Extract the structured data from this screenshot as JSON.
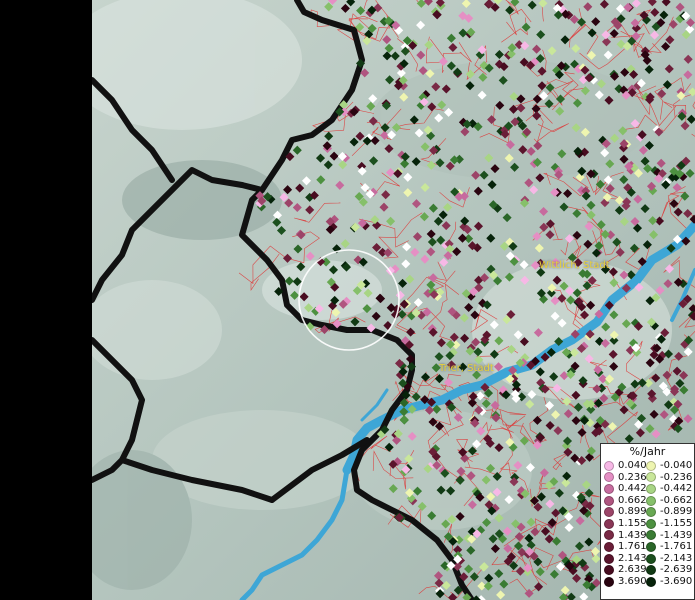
{
  "map": {
    "cities": [
      {
        "name": "Wittlich, Stadt"
      },
      {
        "name": "Trier, Stadt"
      }
    ],
    "colors": {
      "terrain_light": "#c9d6cf",
      "terrain_mid": "#a9bab3",
      "terrain_shadow": "#8a9c96",
      "boundary_major": "#111111",
      "boundary_minor": "#e03030",
      "river": "#3ea6d6",
      "selection_ring": "#ffffff",
      "city_label": "#e8d23a"
    }
  },
  "legend": {
    "title": "%/Jahr",
    "positive": [
      {
        "value": "0.040",
        "color": "#f7b8e6"
      },
      {
        "value": "0.236",
        "color": "#e58fc4"
      },
      {
        "value": "0.442",
        "color": "#c76b9e"
      },
      {
        "value": "0.662",
        "color": "#b05580"
      },
      {
        "value": "0.899",
        "color": "#9c4468"
      },
      {
        "value": "1.155",
        "color": "#8a3656"
      },
      {
        "value": "1.439",
        "color": "#7a2a46"
      },
      {
        "value": "1.761",
        "color": "#6b1e38"
      },
      {
        "value": "2.143",
        "color": "#5a142c"
      },
      {
        "value": "2.639",
        "color": "#480c20"
      },
      {
        "value": "3.690",
        "color": "#2a0410"
      }
    ],
    "negative": [
      {
        "value": "-0.040",
        "color": "#eef5b0"
      },
      {
        "value": "-0.236",
        "color": "#c9e79a"
      },
      {
        "value": "-0.442",
        "color": "#a8d584"
      },
      {
        "value": "-0.662",
        "color": "#86c06a"
      },
      {
        "value": "-0.899",
        "color": "#68a852"
      },
      {
        "value": "-1.155",
        "color": "#4d9140"
      },
      {
        "value": "-1.439",
        "color": "#3a7c33"
      },
      {
        "value": "-1.761",
        "color": "#2a6628"
      },
      {
        "value": "-2.143",
        "color": "#1c501e"
      },
      {
        "value": "-2.639",
        "color": "#113a14"
      },
      {
        "value": "-3.690",
        "color": "#06230a"
      }
    ]
  }
}
